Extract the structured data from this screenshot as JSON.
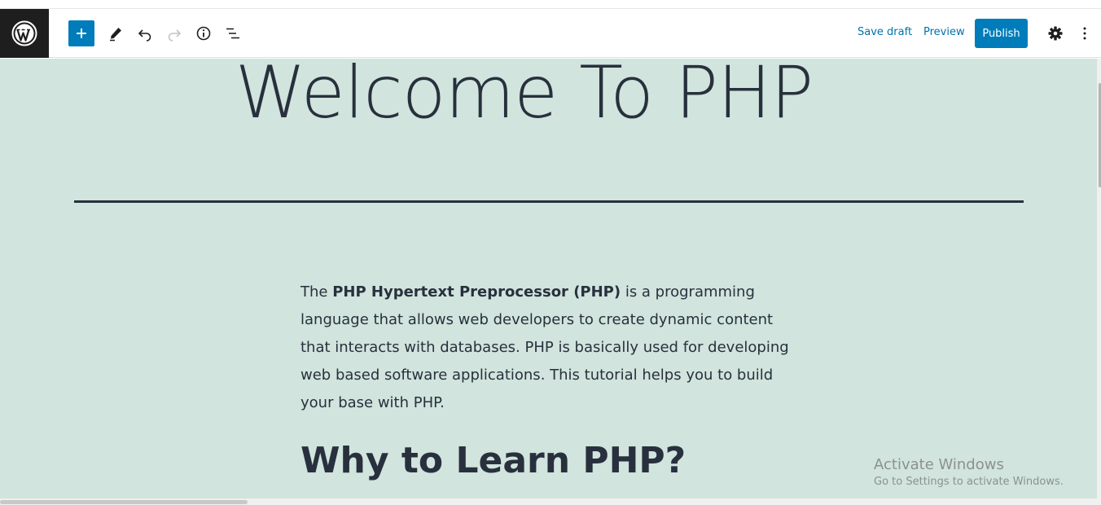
{
  "toolbar": {
    "logo_icon": "wordpress-logo-icon",
    "add_block_icon": "plus-icon",
    "tools_icon": "pencil-icon",
    "undo_icon": "undo-icon",
    "redo_icon": "redo-icon",
    "details_icon": "info-icon",
    "outline_icon": "list-view-icon",
    "save_draft_label": "Save draft",
    "preview_label": "Preview",
    "publish_label": "Publish",
    "settings_icon": "gear-icon",
    "more_icon": "more-vertical-icon",
    "accent_color": "#007cba"
  },
  "editor": {
    "background_color": "#d1e4dd",
    "title": "Welcome To PHP",
    "intro": {
      "prefix": "The ",
      "bold": "PHP Hypertext Preprocessor (PHP)",
      "suffix": " is a programming language that allows web developers to create dynamic content that interacts with databases. PHP is basically used for developing web based software applications. This tutorial helps you to build your base with PHP."
    },
    "heading": "Why to Learn PHP?"
  },
  "watermark": {
    "title": "Activate Windows",
    "subtitle": "Go to Settings to activate Windows."
  }
}
